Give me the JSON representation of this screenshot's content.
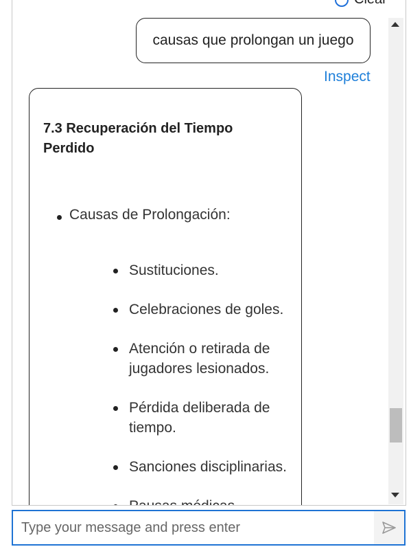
{
  "header": {
    "clear_label": "Clear"
  },
  "conversation": {
    "user_message": "causas que prolongan un juego",
    "inspect_label": "Inspect",
    "bot_message": {
      "title": "7.3 Recuperación del Tiempo Perdido",
      "section": "Causas de Prolongación:",
      "items": [
        "Sustituciones.",
        "Celebraciones de goles.",
        "Atención o retirada de jugadores lesionados.",
        "Pérdida deliberada de tiempo.",
        "Sanciones disciplinarias.",
        "Pausas médicas"
      ]
    }
  },
  "composer": {
    "placeholder": "Type your message and press enter"
  },
  "icons": {
    "clear": "circle-icon",
    "send": "send-icon"
  },
  "colors": {
    "accent": "#1e73d4",
    "link": "#1e7fd9"
  }
}
